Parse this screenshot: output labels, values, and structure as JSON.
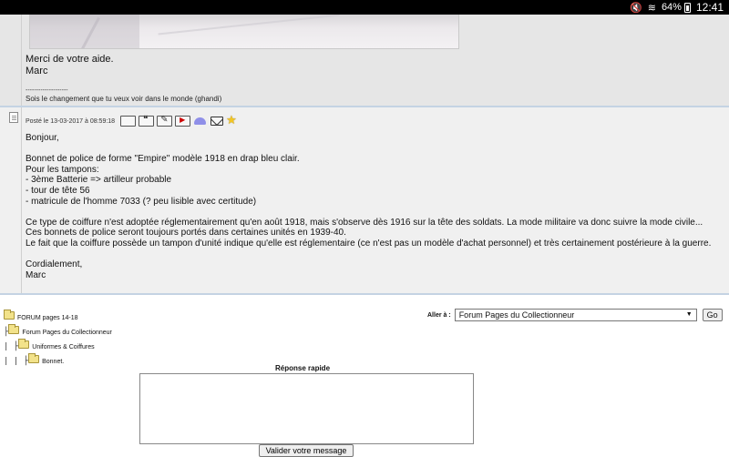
{
  "statusbar": {
    "battery": "64%",
    "time": "12:41",
    "icons": [
      "mute-icon",
      "wifi-icon",
      "battery-icon"
    ]
  },
  "post1": {
    "message_lines": [
      "Merci de votre aide.",
      "Marc"
    ],
    "signature_rule": "--------------------",
    "signature": "Sois le changement que tu veux voir dans le monde (ghandi)"
  },
  "post2": {
    "posted": "Posté le 13-03-2017 à 08:59:18",
    "toolbar_icons": [
      "profile-icon",
      "quote-icon",
      "edit-icon",
      "report-icon",
      "hat-icon",
      "mail-icon",
      "star-icon"
    ],
    "body": [
      "Bonjour,",
      "",
      "Bonnet de police de forme \"Empire\" modèle 1918 en drap bleu clair.",
      "Pour les tampons:",
      "- 3ème Batterie => artilleur probable",
      "- tour de tête 56",
      "- matricule de l'homme 7033 (? peu lisible avec certitude)",
      "",
      "Ce type de coiffure n'est adoptée réglementairement qu'en août 1918, mais s'observe dès 1916 sur la tête des soldats. La mode militaire va donc suivre la mode civile...",
      "Ces bonnets de police seront toujours portés dans certaines unités en 1939-40.",
      "Le fait que la coiffure possède un tampon d'unité indique qu'elle est réglementaire (ce n'est pas un modèle d'achat personnel) et très certainement postérieure à la guerre.",
      "",
      "Cordialement,",
      "Marc"
    ]
  },
  "breadcrumbs": [
    {
      "tree": "",
      "label": "FORUM pages 14-18"
    },
    {
      "tree": "├",
      "label": "Forum Pages du Collectionneur"
    },
    {
      "tree": "| ├",
      "label": "Uniformes & Coiffures"
    },
    {
      "tree": "| | ├",
      "label": "Bonnet."
    }
  ],
  "goto": {
    "label": "Aller à :",
    "selected": "Forum Pages du Collectionneur",
    "button": "Go"
  },
  "quick_reply": {
    "title": "Réponse rapide",
    "submit": "Valider votre message"
  }
}
